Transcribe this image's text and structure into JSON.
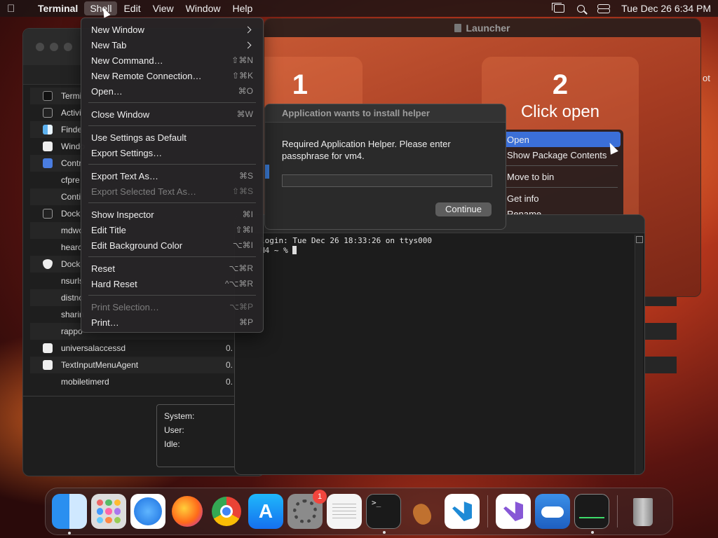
{
  "menubar": {
    "app_name": "Terminal",
    "items": [
      "Shell",
      "Edit",
      "View",
      "Window",
      "Help"
    ],
    "datetime": "Tue Dec 26  6:34 PM"
  },
  "shell_menu": {
    "items": [
      {
        "label": "New Window",
        "shortcut": "",
        "submenu": true,
        "disabled": false
      },
      {
        "label": "New Tab",
        "shortcut": "",
        "submenu": true,
        "disabled": false
      },
      {
        "label": "New Command…",
        "shortcut": "⇧⌘N",
        "submenu": false,
        "disabled": false
      },
      {
        "label": "New Remote Connection…",
        "shortcut": "⇧⌘K",
        "submenu": false,
        "disabled": false
      },
      {
        "label": "Open…",
        "shortcut": "⌘O",
        "submenu": false,
        "disabled": false
      },
      {
        "label": "Close Window",
        "shortcut": "⌘W",
        "submenu": false,
        "disabled": false
      },
      {
        "label": "Use Settings as Default",
        "shortcut": "",
        "submenu": false,
        "disabled": false
      },
      {
        "label": "Export Settings…",
        "shortcut": "",
        "submenu": false,
        "disabled": false
      },
      {
        "label": "Export Text As…",
        "shortcut": "⌘S",
        "submenu": false,
        "disabled": false
      },
      {
        "label": "Export Selected Text As…",
        "shortcut": "⇧⌘S",
        "submenu": false,
        "disabled": true
      },
      {
        "label": "Show Inspector",
        "shortcut": "⌘I",
        "submenu": false,
        "disabled": false
      },
      {
        "label": "Edit Title",
        "shortcut": "⇧⌘I",
        "submenu": false,
        "disabled": false
      },
      {
        "label": "Edit Background Color",
        "shortcut": "⌥⌘I",
        "submenu": false,
        "disabled": false
      },
      {
        "label": "Reset",
        "shortcut": "⌥⌘R",
        "submenu": false,
        "disabled": false
      },
      {
        "label": "Hard Reset",
        "shortcut": "^⌥⌘R",
        "submenu": false,
        "disabled": false
      },
      {
        "label": "Print Selection…",
        "shortcut": "⌥⌘P",
        "submenu": false,
        "disabled": true
      },
      {
        "label": "Print…",
        "shortcut": "⌘P",
        "submenu": false,
        "disabled": false
      }
    ]
  },
  "activity_monitor": {
    "rows": [
      {
        "icon": "terminal-icon",
        "name": "Termi",
        "value": ""
      },
      {
        "icon": "activity-monitor-icon",
        "name": "Activi",
        "value": ""
      },
      {
        "icon": "finder-icon",
        "name": "Finde",
        "value": ""
      },
      {
        "icon": "window-icon",
        "name": "Windo",
        "value": ""
      },
      {
        "icon": "control-center-icon",
        "name": "Contr",
        "value": ""
      },
      {
        "icon": "",
        "name": "cfpre",
        "value": ""
      },
      {
        "icon": "",
        "name": "Conti",
        "value": ""
      },
      {
        "icon": "dock-icon",
        "name": "Dock",
        "value": ""
      },
      {
        "icon": "",
        "name": "mdwc",
        "value": ""
      },
      {
        "icon": "",
        "name": "hearc",
        "value": ""
      },
      {
        "icon": "shield-icon",
        "name": "Dock",
        "value": ""
      },
      {
        "icon": "",
        "name": "nsurls",
        "value": ""
      },
      {
        "icon": "",
        "name": "distnc",
        "value": ""
      },
      {
        "icon": "",
        "name": "sharin",
        "value": ""
      },
      {
        "icon": "",
        "name": "rappo",
        "value": ""
      },
      {
        "icon": "window-icon",
        "name": "universalaccessd",
        "value": "0."
      },
      {
        "icon": "app-icon",
        "name": "TextInputMenuAgent",
        "value": "0."
      },
      {
        "icon": "",
        "name": "mobiletimerd",
        "value": "0."
      }
    ],
    "stats": {
      "system": "System:",
      "user": "User:",
      "idle": "Idle:"
    }
  },
  "launcher": {
    "title": "Launcher",
    "step1_number": "1",
    "step2_number": "2",
    "step2_text": "Click open",
    "context_menu": [
      "Open",
      "Show Package Contents",
      "Move to bin",
      "Get info",
      "Rename"
    ],
    "right_edge_fragment": "ot"
  },
  "dialog": {
    "title": "Application wants to install helper",
    "message": "Required Application Helper. Please enter passphrase for vm4.",
    "password_value": "",
    "button": "Continue"
  },
  "terminal": {
    "line1": "login: Tue Dec 26 18:33:26 on ttys000",
    "line2": "M4 ~ % "
  },
  "dock": {
    "apps": [
      "finder-icon",
      "launchpad-icon",
      "safari-icon",
      "firefox-icon",
      "chrome-icon",
      "app-store-icon",
      "system-settings-icon",
      "textedit-icon",
      "terminal-icon",
      "garageband-icon",
      "vscode-icon",
      "visual-studio-icon",
      "weather-icon",
      "activity-monitor-icon",
      "trash-icon"
    ],
    "settings_badge": "1"
  }
}
